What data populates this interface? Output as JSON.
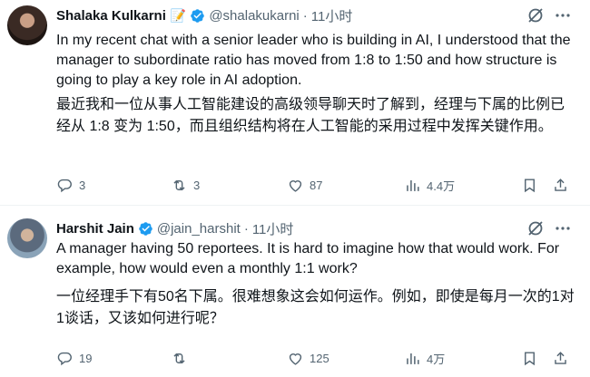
{
  "posts": [
    {
      "name": "Shalaka Kulkarni",
      "name_emoji": "📝",
      "handle": "@shalakukarni",
      "separator": "·",
      "time": "11小时",
      "text_en": "In my recent chat with a senior leader who is building in AI, I understood that the manager to subordinate ratio has moved from 1:8 to 1:50 and how structure is going to play a key role in AI adoption.",
      "text_zh": "最近我和一位从事人工智能建设的高级领导聊天时了解到，经理与下属的比例已经从 1:8 变为 1:50，而且组织结构将在人工智能的采用过程中发挥关键作用。",
      "replies": "3",
      "reposts": "3",
      "likes": "87",
      "views": "4.4万"
    },
    {
      "name": "Harshit Jain",
      "name_emoji": "",
      "handle": "@jain_harshit",
      "separator": "·",
      "time": "11小时",
      "text_en": "A manager having 50 reportees. It is hard to imagine how that would work. For example, how would even a monthly 1:1 work?",
      "text_zh": "一位经理手下有50名下属。很难想象这会如何运作。例如，即使是每月一次的1对1谈话，又该如何进行呢？",
      "replies": "19",
      "reposts": "",
      "likes": "125",
      "views": "4万"
    }
  ],
  "icons": {
    "verified": "verified-badge-icon",
    "grok": "grok-icon",
    "more": "more-icon",
    "reply": "reply-icon",
    "repost": "repost-icon",
    "like": "heart-icon",
    "views": "views-chart-icon",
    "bookmark": "bookmark-icon",
    "share": "share-icon"
  },
  "colors": {
    "verified": "#1d9bf0",
    "secondary_text": "#536471",
    "primary_text": "#0f1419"
  }
}
